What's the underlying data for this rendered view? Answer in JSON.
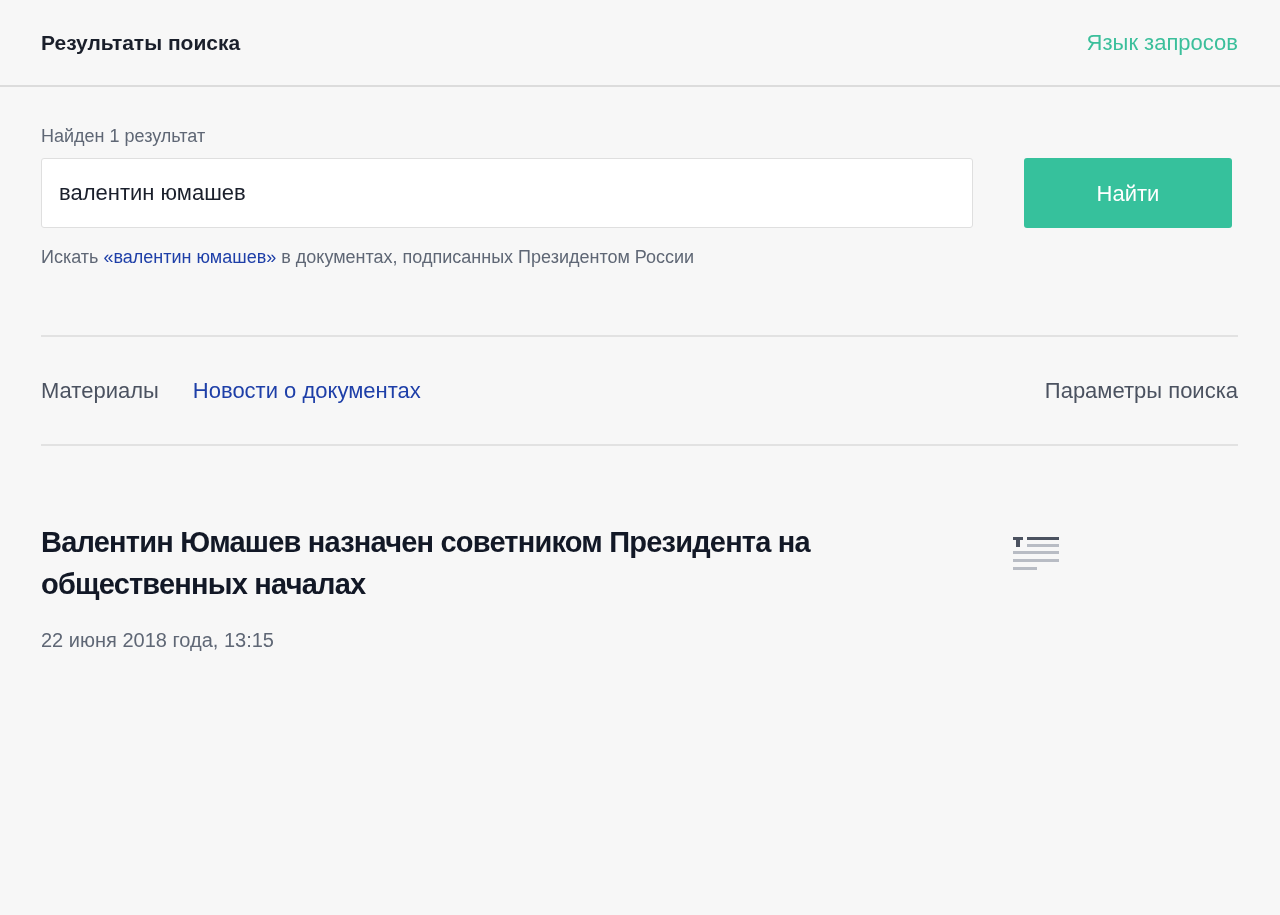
{
  "header": {
    "title": "Результаты поиска",
    "query_language_link": "Язык запросов"
  },
  "search": {
    "count_text": "Найден 1 результат",
    "value": "валентин юмашев",
    "button": "Найти",
    "hint": {
      "prefix": "Искать",
      "link": "«валентин юмашев»",
      "suffix": "в документах, подписанных Президентом России"
    }
  },
  "tabs": [
    {
      "label": "Материалы",
      "selected": true
    },
    {
      "label": "Новости о документах",
      "selected": false
    }
  ],
  "search_params_link": "Параметры поиска",
  "results": [
    {
      "title": "Валентин Юмашев назначен советником Президента на общественных началах",
      "date": "22 июня 2018 года, 13:15"
    }
  ]
}
